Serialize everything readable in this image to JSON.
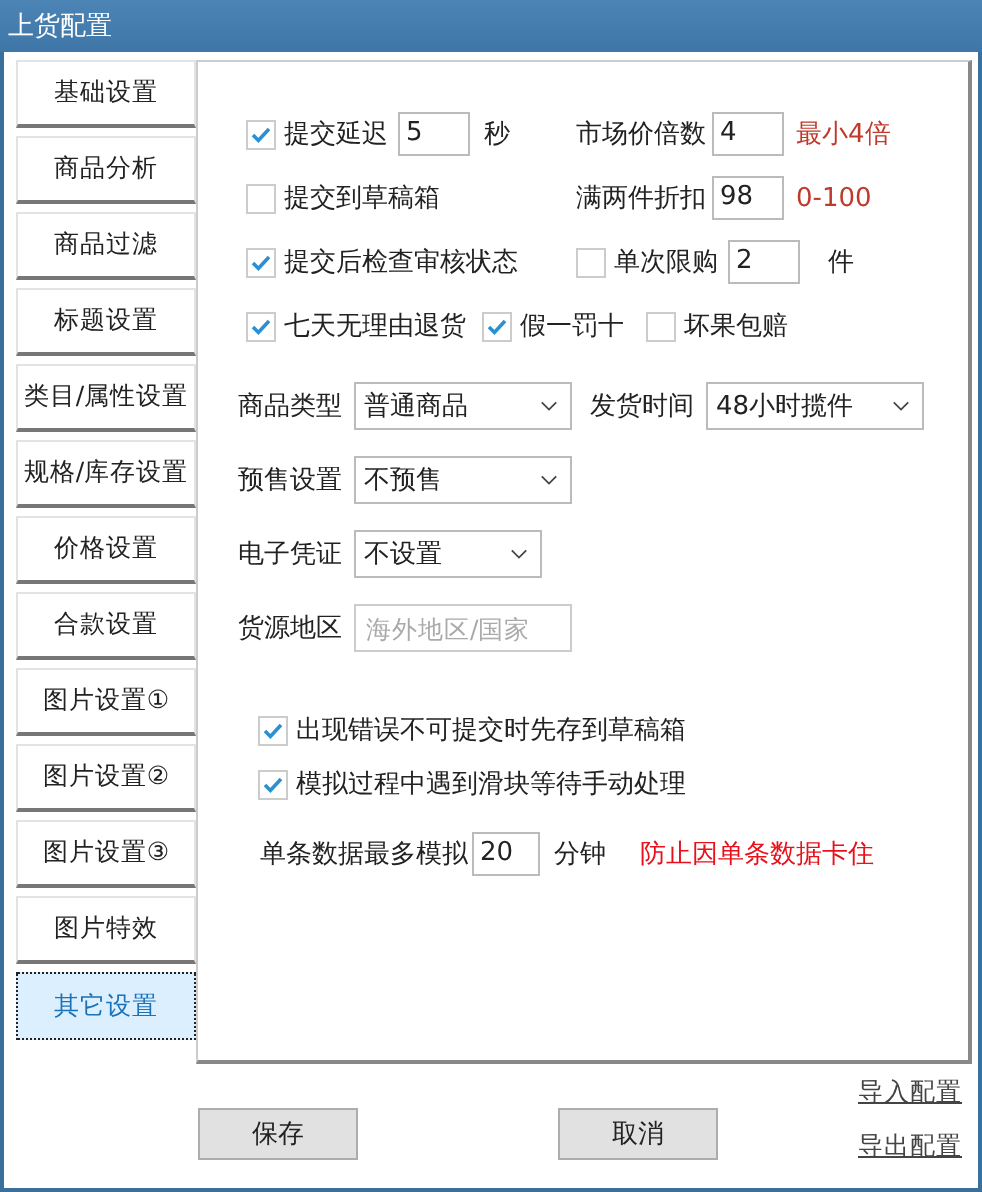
{
  "window": {
    "title": "上货配置"
  },
  "tabs": [
    {
      "label": "基础设置",
      "selected": false
    },
    {
      "label": "商品分析",
      "selected": false
    },
    {
      "label": "商品过滤",
      "selected": false
    },
    {
      "label": "标题设置",
      "selected": false
    },
    {
      "label": "类目/属性设置",
      "selected": false
    },
    {
      "label": "规格/库存设置",
      "selected": false
    },
    {
      "label": "价格设置",
      "selected": false
    },
    {
      "label": "合款设置",
      "selected": false
    },
    {
      "label": "图片设置①",
      "selected": false
    },
    {
      "label": "图片设置②",
      "selected": false
    },
    {
      "label": "图片设置③",
      "selected": false
    },
    {
      "label": "图片特效",
      "selected": false
    },
    {
      "label": "其它设置",
      "selected": true
    }
  ],
  "options": {
    "submit_delay": {
      "label": "提交延迟",
      "checked": true,
      "value": "5",
      "unit": "秒"
    },
    "market_multiple": {
      "label": "市场价倍数",
      "value": "4",
      "hint": "最小4倍"
    },
    "submit_to_drafts": {
      "label": "提交到草稿箱",
      "checked": false
    },
    "two_piece_discount": {
      "label": "满两件折扣",
      "value": "98",
      "hint": "0-100"
    },
    "check_review": {
      "label": "提交后检查审核状态",
      "checked": true
    },
    "purchase_limit": {
      "label": "单次限购",
      "checked": false,
      "value": "2",
      "unit": "件"
    },
    "guarantees": [
      {
        "label": "七天无理由退货",
        "checked": true
      },
      {
        "label": "假一罚十",
        "checked": true
      },
      {
        "label": "坏果包赔",
        "checked": false
      }
    ]
  },
  "selects": [
    {
      "label": "商品类型",
      "value": "普通商品"
    },
    {
      "label": "发货时间",
      "value": "48小时揽件"
    },
    {
      "label": "预售设置",
      "value": "不预售"
    },
    {
      "label": "电子凭证",
      "value": "不设置"
    }
  ],
  "origin": {
    "label": "货源地区",
    "placeholder": "海外地区/国家"
  },
  "extra_checks": [
    {
      "label": "出现错误不可提交时先存到草稿箱",
      "checked": true
    },
    {
      "label": "模拟过程中遇到滑块等待手动处理",
      "checked": true
    }
  ],
  "max_sim": {
    "label": "单条数据最多模拟",
    "value": "20",
    "unit": "分钟",
    "hint": "防止因单条数据卡住"
  },
  "buttons": [
    "保存",
    "取消"
  ],
  "links": [
    "导入配置",
    "导出配置"
  ]
}
